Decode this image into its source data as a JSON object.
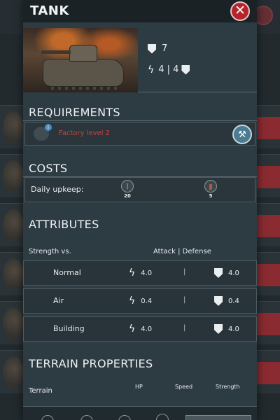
{
  "modal": {
    "title": "TANK",
    "close_icon": "close-icon"
  },
  "unit_stats": {
    "defense_value": "7",
    "attack_line": "4 | 4"
  },
  "requirements": {
    "heading": "REQUIREMENTS",
    "item_text": "Factory level 2",
    "action_icon": "hammer-icon"
  },
  "costs": {
    "heading": "COSTS",
    "daily_label": "Daily upkeep:",
    "items": [
      {
        "icon": "grain-icon",
        "value": "20"
      },
      {
        "icon": "barrel-icon",
        "value": "5"
      }
    ]
  },
  "attributes": {
    "heading": "ATTRIBUTES",
    "col_label": "Strength vs.",
    "col_values": "Attack | Defense",
    "separator": "|",
    "rows": [
      {
        "name": "Normal",
        "attack": "4.0",
        "defense": "4.0"
      },
      {
        "name": "Air",
        "attack": "0.4",
        "defense": "0.4"
      },
      {
        "name": "Building",
        "attack": "4.0",
        "defense": "4.0"
      }
    ]
  },
  "terrain": {
    "heading": "TERRAIN PROPERTIES",
    "col_terrain": "Terrain",
    "col_hp": "HP",
    "col_speed": "Speed",
    "col_strength": "Strength"
  },
  "colors": {
    "accent_red": "#b5242c",
    "requirement_text": "#c8453e",
    "panel_bg": "#2d3b42"
  }
}
